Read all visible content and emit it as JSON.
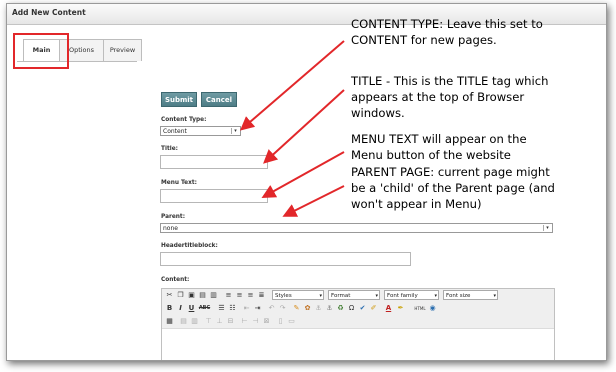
{
  "window": {
    "title": "Add New Content"
  },
  "tabs": [
    {
      "label": "Main",
      "active": true
    },
    {
      "label": "Options",
      "active": false
    },
    {
      "label": "Preview",
      "active": false
    }
  ],
  "buttons": {
    "submit": "Submit",
    "cancel": "Cancel"
  },
  "form": {
    "content_type": {
      "label": "Content Type:",
      "value": "Content"
    },
    "title": {
      "label": "Title:",
      "value": ""
    },
    "menu_text": {
      "label": "Menu Text:",
      "value": ""
    },
    "parent": {
      "label": "Parent:",
      "value": "none"
    },
    "headertitleblock": {
      "label": "Headertitleblock:",
      "value": ""
    },
    "content": {
      "label": "Content:"
    }
  },
  "editor": {
    "styles_label": "Styles",
    "format_label": "Format",
    "font_family_label": "Font family",
    "font_size_label": "Font size",
    "bold": "B",
    "italic": "I",
    "underline": "U",
    "strike": "ABC",
    "html": "HTML"
  },
  "annotations": {
    "content_type": [
      "CONTENT TYPE: Leave this set to",
      "CONTENT for new pages."
    ],
    "title": [
      "TITLE - This is the TITLE tag which",
      "appears at the top of Browser",
      "windows."
    ],
    "menu_text": [
      "MENU TEXT will appear on the",
      "Menu button of the website"
    ],
    "parent": [
      "PARENT PAGE: current page might",
      "be a 'child' of the Parent page (and",
      "won't appear in Menu)"
    ]
  },
  "colors": {
    "arrow": "#e2272a",
    "highlight": "#e2272a",
    "button": "#5a8a93"
  }
}
